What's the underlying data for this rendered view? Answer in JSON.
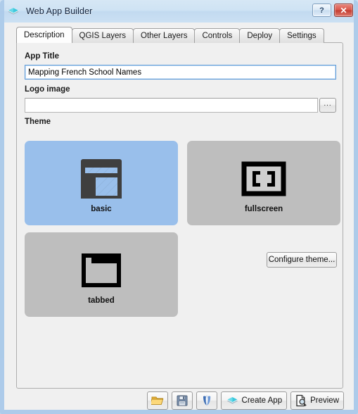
{
  "window": {
    "title": "Web App Builder",
    "icon": "layers-diamond-icon",
    "help_label": "?",
    "close_label": "✕"
  },
  "tabs": [
    {
      "label": "Description",
      "active": true
    },
    {
      "label": "QGIS Layers",
      "active": false
    },
    {
      "label": "Other Layers",
      "active": false
    },
    {
      "label": "Controls",
      "active": false
    },
    {
      "label": "Deploy",
      "active": false
    },
    {
      "label": "Settings",
      "active": false
    }
  ],
  "form": {
    "app_title_label": "App Title",
    "app_title_value": "Mapping French School Names",
    "app_title_placeholder": "",
    "logo_label": "Logo image",
    "logo_value": "",
    "logo_placeholder": "",
    "browse_label": "..."
  },
  "theme": {
    "section_label": "Theme",
    "selected": "basic",
    "cards": [
      {
        "label": "basic",
        "icon": "window-layout-icon",
        "selected": true
      },
      {
        "label": "fullscreen",
        "icon": "fullscreen-corners-icon",
        "selected": false
      },
      {
        "label": "tabbed",
        "icon": "tabbed-folder-icon",
        "selected": false
      }
    ],
    "configure_label": "Configure theme..."
  },
  "bottom_bar": {
    "buttons": [
      {
        "name": "open-project-button",
        "icon": "open-folder-icon",
        "label": ""
      },
      {
        "name": "save-project-button",
        "icon": "floppy-disk-icon",
        "label": ""
      },
      {
        "name": "save-as-button",
        "icon": "qgis-tulip-icon",
        "label": ""
      },
      {
        "name": "create-app-button",
        "icon": "layers-diamond-icon",
        "label": "Create App"
      },
      {
        "name": "preview-button",
        "icon": "page-magnifier-icon",
        "label": "Preview"
      }
    ]
  },
  "colors": {
    "titlebar": "#cfe3f4",
    "frame": "#accbe9",
    "panel": "#f0f0f0",
    "selected_card": "#99bfeb",
    "card": "#bebebe",
    "accent_cyan": "#3ec8dc",
    "focus_blue": "#5d9ad8",
    "close_red": "#d9584c"
  }
}
